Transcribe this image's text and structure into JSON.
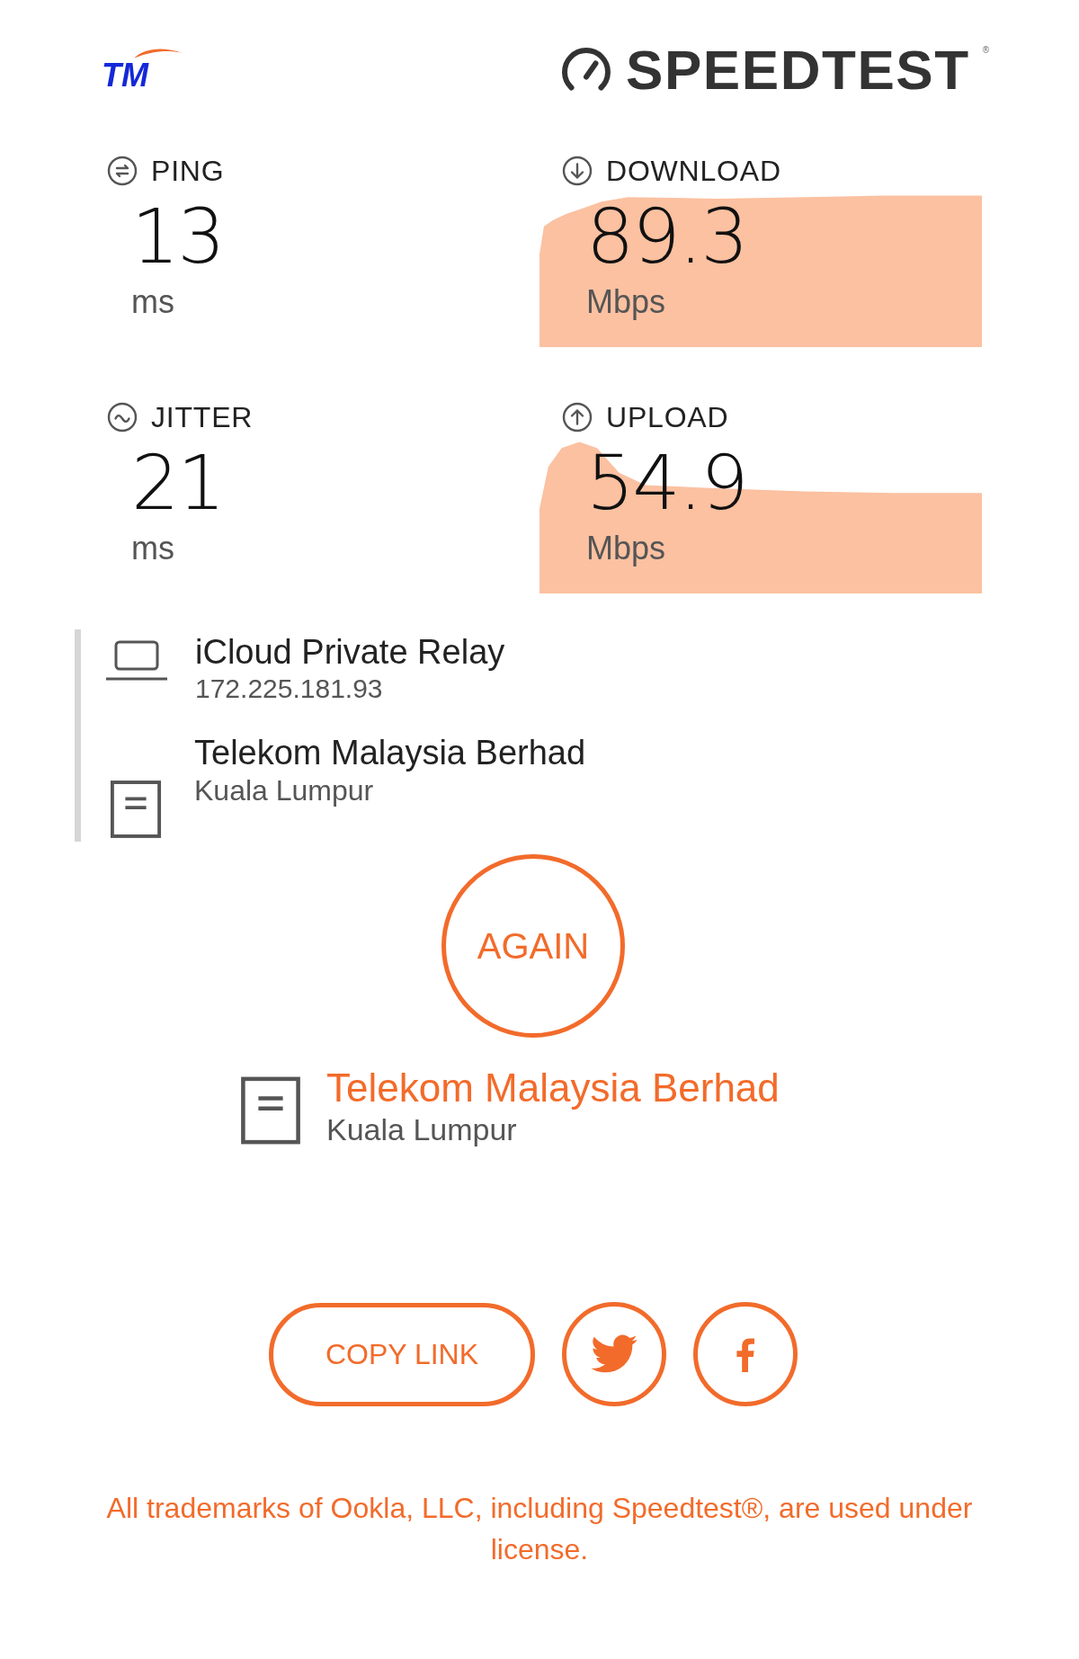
{
  "header": {
    "brand": "TM",
    "logo_text": "SPEEDTEST",
    "logo_mark": "®"
  },
  "metrics": [
    {
      "kind": "ping",
      "label": "PING",
      "value": "13",
      "unit": "ms"
    },
    {
      "kind": "download",
      "label": "DOWNLOAD",
      "value": "89.3",
      "unit": "Mbps"
    },
    {
      "kind": "jitter",
      "label": "JITTER",
      "value": "21",
      "unit": "ms"
    },
    {
      "kind": "upload",
      "label": "UPLOAD",
      "value": "54.9",
      "unit": "Mbps"
    }
  ],
  "connection": {
    "client": {
      "name": "iCloud Private Relay",
      "ip": "172.225.181.93"
    },
    "server": {
      "name": "Telekom Malaysia Berhad",
      "location": "Kuala Lumpur"
    }
  },
  "again_button": "AGAIN",
  "selected_server": {
    "name": "Telekom Malaysia Berhad",
    "location": "Kuala Lumpur"
  },
  "share": {
    "copy_link": "COPY LINK",
    "buttons": [
      {
        "kind": "twitter"
      },
      {
        "kind": "facebook"
      }
    ]
  },
  "footer": "All trademarks of Ookla, LLC, including Speedtest®, are used under license."
}
